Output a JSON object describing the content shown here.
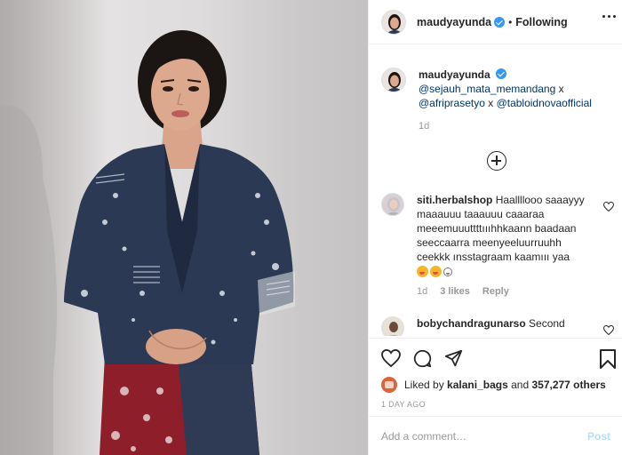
{
  "colors": {
    "accent": "#3897f0",
    "text": "#262626",
    "muted": "#999999",
    "mention": "#003569",
    "post_disabled": "#b2dffc"
  },
  "header": {
    "username": "maudyayunda",
    "separator": "•",
    "follow_status": "Following"
  },
  "caption": {
    "username": "maudyayunda",
    "mentions": [
      "@sejauh_mata_memandang",
      "@afriprasetyo",
      "@tabloidnovaofficial"
    ],
    "joiner": " x ",
    "time": "1d"
  },
  "comments": [
    {
      "username": "siti.herbalshop",
      "text": "Haallllooo saaayyy\nmaaauuu taaauuu caaaraa\nmeeemuuuttttıııhhkaann baadaan\nseeccaarra meenyeeluurruuhh\nceekkk ınsstagraam kaamııı yaa",
      "emojis": [
        "laughing-emoji",
        "laughing-emoji",
        "grin-emoji"
      ],
      "time": "1d",
      "likes": "3 likes",
      "reply": "Reply"
    },
    {
      "username": "bobychandragunarso",
      "text": "Second"
    }
  ],
  "likes": {
    "prefix": "Liked by",
    "user": "kalani_bags",
    "joiner": "and",
    "count": "357,277 others"
  },
  "date": "1 DAY AGO",
  "add_comment": {
    "placeholder": "Add a comment…",
    "post_label": "Post"
  }
}
